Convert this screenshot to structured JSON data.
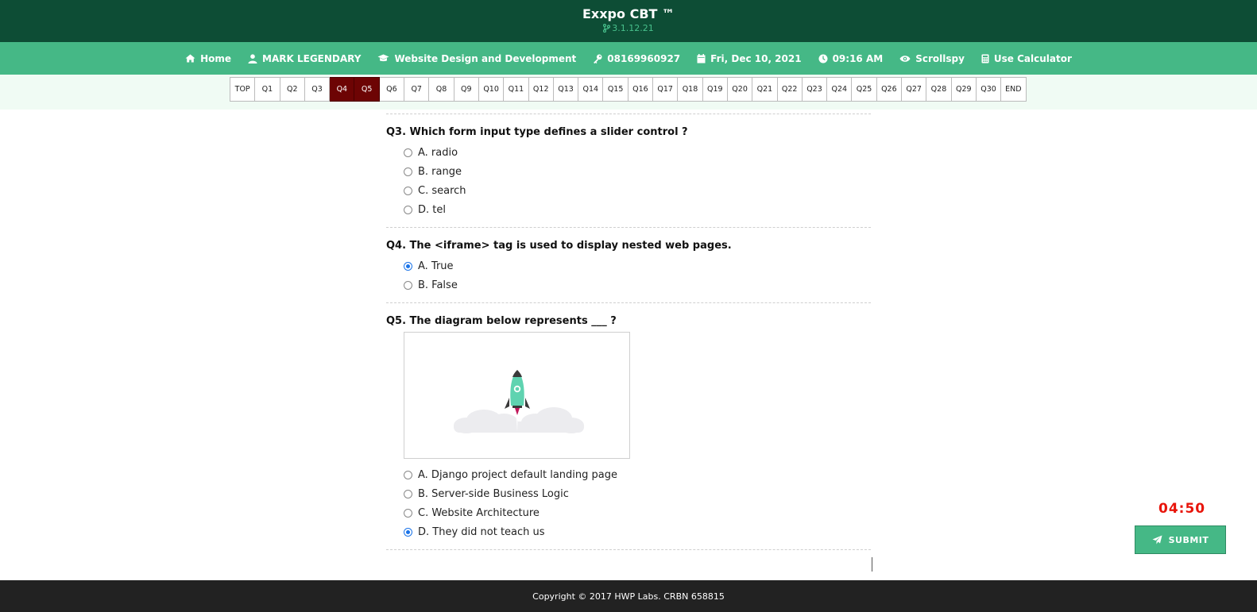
{
  "header": {
    "title": "Exxpo CBT ™",
    "version": "3.1.12.21",
    "version_icon": "git-branch-icon",
    "bg_color": "#0d4d35"
  },
  "nav": {
    "bg_color": "#45b886",
    "items": [
      {
        "label": "Home",
        "icon": "home-icon"
      },
      {
        "label": "MARK LEGENDARY",
        "icon": "user-icon"
      },
      {
        "label": "Website Design and Development",
        "icon": "graduation-cap-icon"
      },
      {
        "label": "08169960927",
        "icon": "key-icon"
      },
      {
        "label": "Fri, Dec 10, 2021",
        "icon": "calendar-icon"
      },
      {
        "label": "09:16 AM",
        "icon": "clock-icon"
      },
      {
        "label": "Scrollspy",
        "icon": "eye-icon"
      },
      {
        "label": "Use Calculator",
        "icon": "calculator-icon"
      }
    ]
  },
  "question_nav": {
    "active": [
      "Q4",
      "Q5"
    ],
    "active_color": "#6d0404",
    "items": [
      "TOP",
      "Q1",
      "Q2",
      "Q3",
      "Q4",
      "Q5",
      "Q6",
      "Q7",
      "Q8",
      "Q9",
      "Q10",
      "Q11",
      "Q12",
      "Q13",
      "Q14",
      "Q15",
      "Q16",
      "Q17",
      "Q18",
      "Q19",
      "Q20",
      "Q21",
      "Q22",
      "Q23",
      "Q24",
      "Q25",
      "Q26",
      "Q27",
      "Q28",
      "Q29",
      "Q30",
      "END"
    ]
  },
  "questions": [
    {
      "id": "q3",
      "text": "Q3. Which form input type defines a slider control ?",
      "options": [
        {
          "label": "A. radio",
          "checked": false
        },
        {
          "label": "B. range",
          "checked": false
        },
        {
          "label": "C. search",
          "checked": false
        },
        {
          "label": "D. tel",
          "checked": false
        }
      ]
    },
    {
      "id": "q4",
      "text": "Q4. The <iframe> tag is used to display nested web pages.",
      "options": [
        {
          "label": "A. True",
          "checked": true
        },
        {
          "label": "B. False",
          "checked": false
        }
      ]
    },
    {
      "id": "q5",
      "text": "Q5. The diagram below represents ___ ?",
      "image": "rocket-launch-illustration",
      "options": [
        {
          "label": "A. Django project default landing page",
          "checked": false
        },
        {
          "label": "B. Server-side Business Logic",
          "checked": false
        },
        {
          "label": "C. Website Architecture",
          "checked": false
        },
        {
          "label": "D. They did not teach us",
          "checked": true
        }
      ]
    }
  ],
  "timer": {
    "value": "04:50",
    "color": "#e8140a"
  },
  "submit": {
    "label": "SUBMIT",
    "icon": "paper-plane-icon"
  },
  "footer": {
    "text": "Copyright © 2017 HWP Labs. CRBN 658815"
  }
}
